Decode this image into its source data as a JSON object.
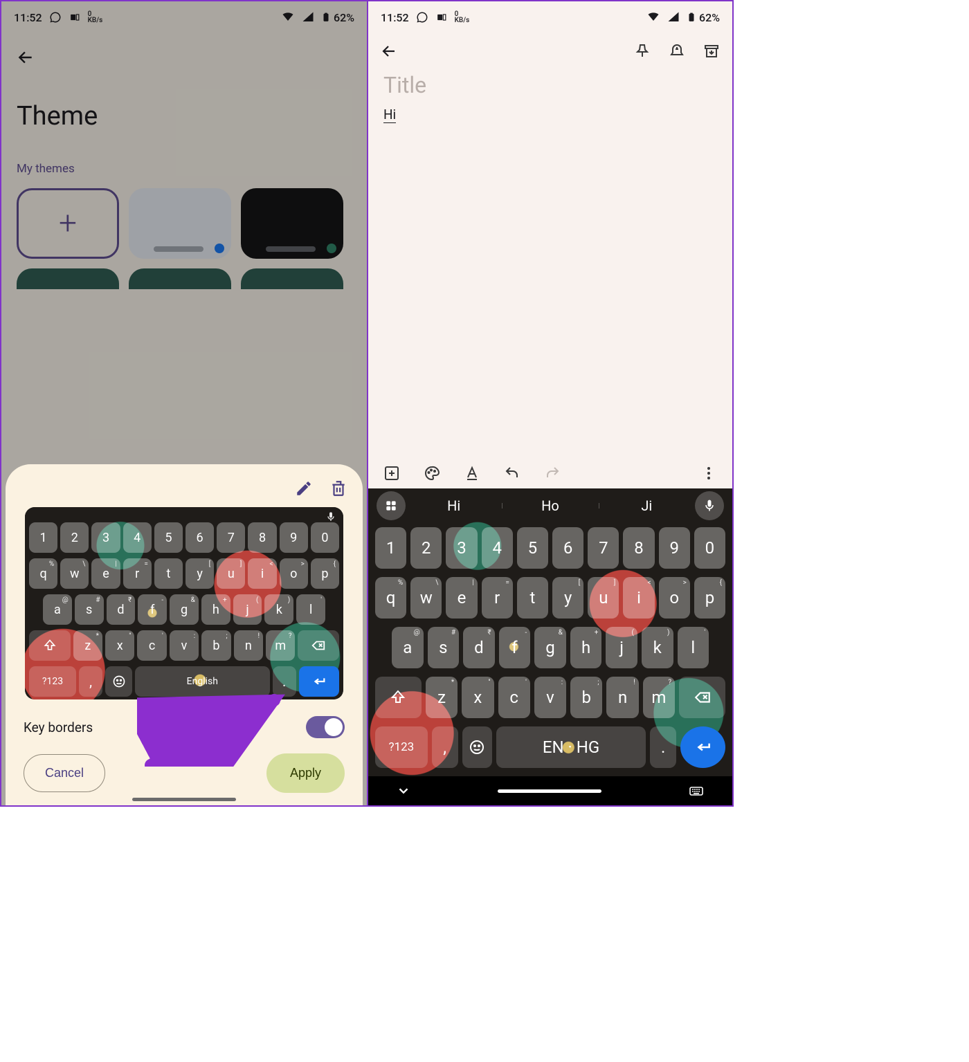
{
  "status": {
    "time": "11:52",
    "kbs_top": "0",
    "kbs_bot": "KB/s",
    "battery": "62%"
  },
  "left": {
    "page_title": "Theme",
    "section_label": "My themes",
    "sheet": {
      "key_borders_label": "Key borders",
      "cancel": "Cancel",
      "apply": "Apply",
      "space_label": "English",
      "sym_label": "?123"
    }
  },
  "right": {
    "title_placeholder": "Title",
    "body_text": "Hi",
    "suggestions": [
      "Hi",
      "Ho",
      "Ji"
    ],
    "space_label": "EN · HG",
    "sym_label": "?123"
  },
  "kb": {
    "row1": [
      "1",
      "2",
      "3",
      "4",
      "5",
      "6",
      "7",
      "8",
      "9",
      "0"
    ],
    "row2": [
      "q",
      "w",
      "e",
      "r",
      "t",
      "y",
      "u",
      "i",
      "o",
      "p"
    ],
    "row2_sup": [
      "%",
      "\\",
      "|",
      "=",
      "",
      "[",
      "]",
      "<",
      ">",
      "{",
      "}"
    ],
    "row3": [
      "a",
      "s",
      "d",
      "f",
      "g",
      "h",
      "j",
      "k",
      "l"
    ],
    "row3_sup": [
      "@",
      "#",
      "₹",
      "-",
      "&",
      "+",
      "(",
      ")",
      "'"
    ],
    "row4": [
      "z",
      "x",
      "c",
      "v",
      "b",
      "n",
      "m"
    ],
    "row4_sup": [
      "*",
      "\"",
      "'",
      ":",
      ";",
      "!",
      "?"
    ]
  }
}
